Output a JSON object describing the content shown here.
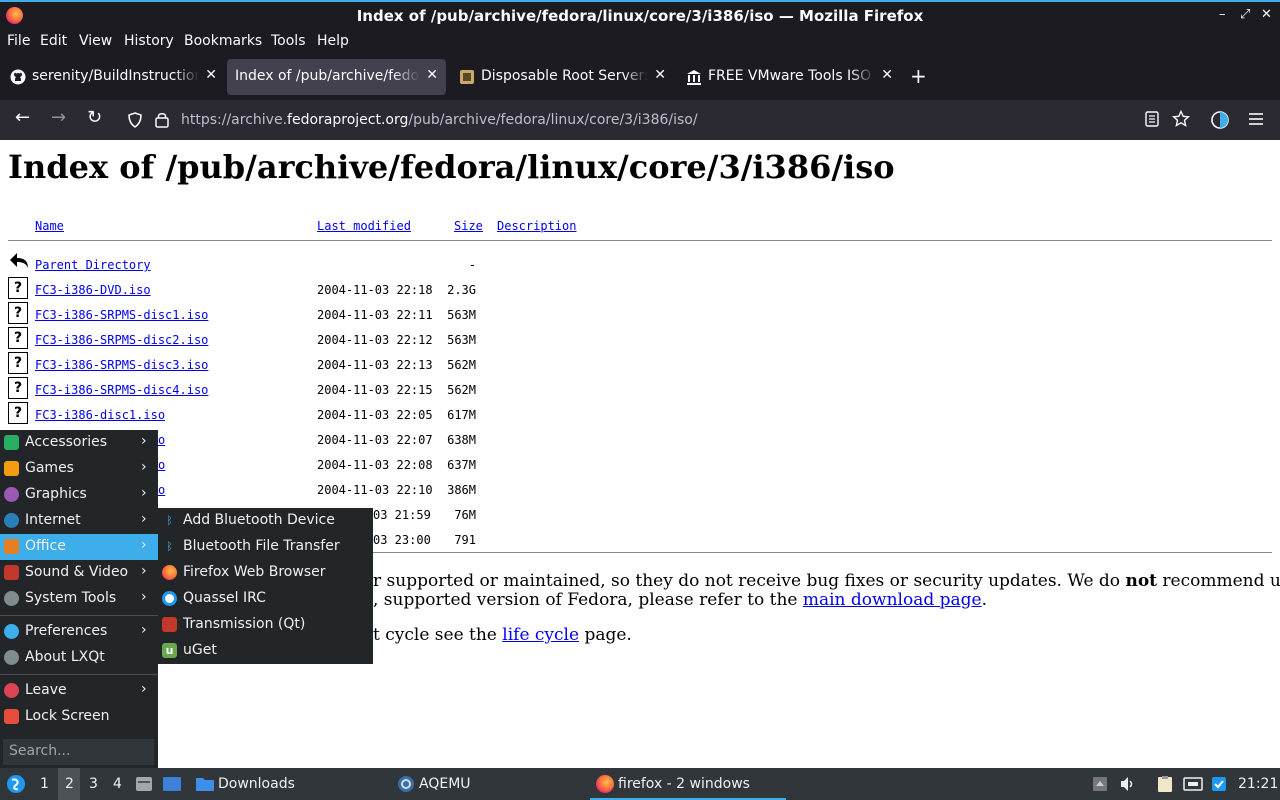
{
  "window": {
    "title": "Index of /pub/archive/fedora/linux/core/3/i386/iso — Mozilla Firefox",
    "controls": [
      "–",
      "⤢",
      "✕"
    ]
  },
  "menubar": [
    "File",
    "Edit",
    "View",
    "History",
    "Bookmarks",
    "Tools",
    "Help"
  ],
  "tabs": [
    {
      "label": "serenity/BuildInstructions",
      "favicon": "github-icon"
    },
    {
      "label": "Index of /pub/archive/fedora",
      "favicon": "blank-icon",
      "active": true
    },
    {
      "label": "Disposable Root Servers",
      "favicon": "server-icon"
    },
    {
      "label": "FREE VMware Tools ISO",
      "favicon": "library-icon"
    }
  ],
  "newtab": "+",
  "nav": {
    "back": "←",
    "forward": "→",
    "reload": "↻",
    "url_prefix": "https://archive.",
    "url_domain": "fedoraproject.org",
    "url_path": "/pub/archive/fedora/linux/core/3/i386/iso/"
  },
  "page": {
    "heading": "Index of /pub/archive/fedora/linux/core/3/i386/iso",
    "columns": {
      "name": "Name",
      "modified": "Last modified",
      "size": "Size",
      "description": "Description"
    },
    "parent": {
      "name": "Parent Directory",
      "size": "-"
    },
    "files": [
      {
        "name": "FC3-i386-DVD.iso",
        "modified": "2004-11-03 22:18",
        "size": "2.3G"
      },
      {
        "name": "FC3-i386-SRPMS-disc1.iso",
        "modified": "2004-11-03 22:11",
        "size": "563M"
      },
      {
        "name": "FC3-i386-SRPMS-disc2.iso",
        "modified": "2004-11-03 22:12",
        "size": "563M"
      },
      {
        "name": "FC3-i386-SRPMS-disc3.iso",
        "modified": "2004-11-03 22:13",
        "size": "562M"
      },
      {
        "name": "FC3-i386-SRPMS-disc4.iso",
        "modified": "2004-11-03 22:15",
        "size": "562M"
      },
      {
        "name": "FC3-i386-disc1.iso",
        "modified": "2004-11-03 22:05",
        "size": "617M"
      },
      {
        "name": "o",
        "modified": "2004-11-03 22:07",
        "size": "638M"
      },
      {
        "name": "o",
        "modified": "2004-11-03 22:08",
        "size": "637M"
      },
      {
        "name": "o",
        "modified": "2004-11-03 22:10",
        "size": "386M"
      },
      {
        "name": "",
        "modified": "03 21:59",
        "size": "76M"
      },
      {
        "name": "",
        "modified": "03 23:00",
        "size": "791"
      }
    ],
    "para1_a": "r supported or maintained, so they do not receive bug fixes or security updates. We do ",
    "para1_b": "not",
    "para1_c": " recommend using",
    "para2_a": ", supported version of Fedora, please refer to the ",
    "para2_link": "main download page",
    "para2_b": ".",
    "para3_a": "t cycle see the ",
    "para3_link": "life cycle",
    "para3_b": " page."
  },
  "startmenu": {
    "items": [
      {
        "label": "Accessories",
        "icon": "accessories-icon",
        "color": "#27ae60"
      },
      {
        "label": "Games",
        "icon": "games-icon",
        "color": "#f39c12"
      },
      {
        "label": "Graphics",
        "icon": "graphics-icon",
        "color": "#9b59b6"
      },
      {
        "label": "Internet",
        "icon": "internet-icon",
        "color": "#2980b9"
      },
      {
        "label": "Office",
        "icon": "office-icon",
        "color": "#e67e22"
      },
      {
        "label": "Sound & Video",
        "icon": "sound-video-icon",
        "color": "#c0392b"
      },
      {
        "label": "System Tools",
        "icon": "system-tools-icon",
        "color": "#7f8c8d"
      },
      {
        "label": "Preferences",
        "icon": "preferences-icon",
        "color": "#3daee9"
      },
      {
        "label": "About LXQt",
        "icon": "about-icon",
        "color": "#7f8c8d"
      },
      {
        "label": "Leave",
        "icon": "leave-icon",
        "color": "#da4453"
      },
      {
        "label": "Lock Screen",
        "icon": "lock-icon",
        "color": "#e74c3c"
      }
    ],
    "search_placeholder": "Search..."
  },
  "submenu": {
    "items": [
      {
        "label": "Add Bluetooth Device",
        "icon": "bluetooth-icon"
      },
      {
        "label": "Bluetooth File Transfer",
        "icon": "bluetooth-icon"
      },
      {
        "label": "Firefox Web Browser",
        "icon": "firefox-icon"
      },
      {
        "label": "Quassel IRC",
        "icon": "quassel-icon"
      },
      {
        "label": "Transmission (Qt)",
        "icon": "transmission-icon"
      },
      {
        "label": "uGet",
        "icon": "uget-icon"
      }
    ]
  },
  "taskbar": {
    "desktops": [
      "1",
      "2",
      "3",
      "4"
    ],
    "downloads": "Downloads",
    "aqemu": "AQEMU",
    "firefox": "firefox - 2 windows",
    "clock": "21:21"
  }
}
